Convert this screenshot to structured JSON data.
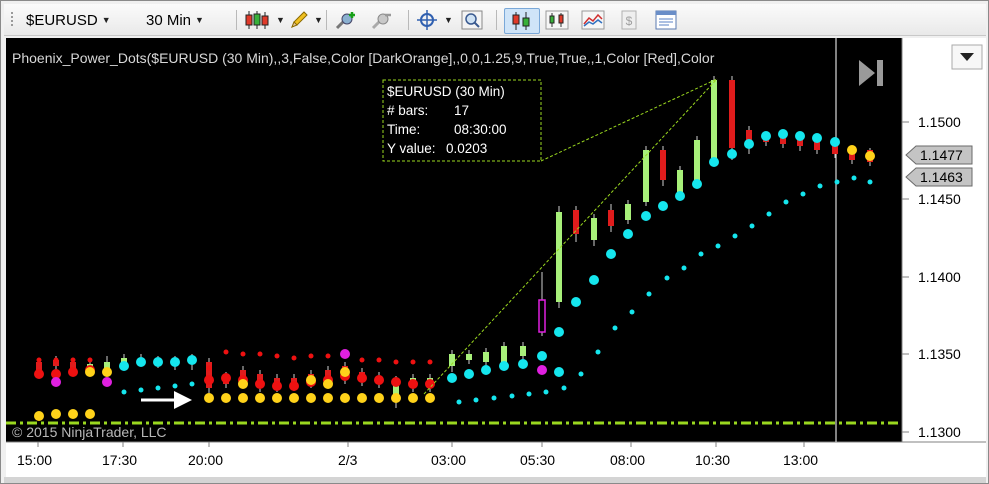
{
  "toolbar": {
    "instrument": "$EURUSD",
    "interval": "30 Min",
    "icons": [
      "candlestick-style-icon",
      "pencil-draw-icon",
      "add-indicator-icon",
      "remove-indicator-icon",
      "crosshair-icon",
      "zoom-icon",
      "chart-trader-icon",
      "bars-icon",
      "line-chart-icon",
      "dollar-icon",
      "properties-icon"
    ]
  },
  "chart": {
    "indicator_label": "Phoenix_Power_Dots($EURUSD (30 Min),,3,False,Color [DarkOrange],,0,0,1.25,9,True,True,,1,Color [Red],Color",
    "copyright": "© 2015 NinjaTrader, LLC",
    "price_ticks": [
      "1.1500",
      "1.1450",
      "1.1400",
      "1.1350",
      "1.1300"
    ],
    "price_badges": [
      "1.1477",
      "1.1463"
    ],
    "time_ticks": [
      "15:00",
      "17:30",
      "20:00",
      "2/3",
      "03:00",
      "05:30",
      "08:00",
      "10:30",
      "13:00"
    ],
    "tooltip": {
      "line1": "$EURUSD (30 Min)",
      "bars_label": "# bars:",
      "bars_value": "17",
      "time_label": "Time:",
      "time_value": "08:30:00",
      "y_label": "Y value:",
      "y_value": "0.0203"
    },
    "colors": {
      "background": "#000000",
      "up_candle": "#a8f07a",
      "down_candle": "#e01c1c",
      "cyan_dot": "#15e6ee",
      "yellow_dot": "#ffd21a",
      "red_dot": "#ee1111",
      "magenta_dot": "#e020e0",
      "green_line": "#9ad81f"
    }
  }
}
